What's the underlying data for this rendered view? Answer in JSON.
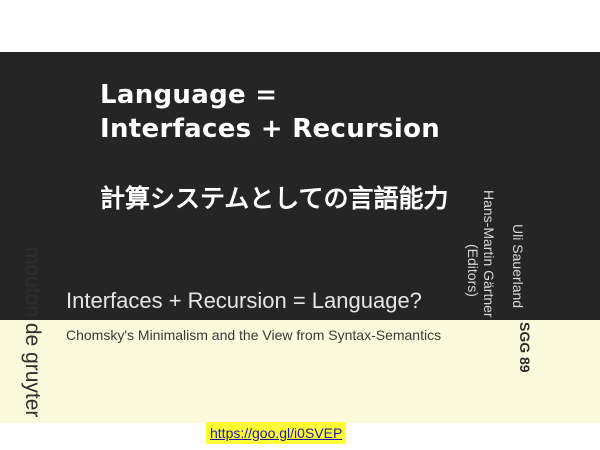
{
  "slide": {
    "title_line1": "Language =",
    "title_line2": "Interfaces + Recursion",
    "subtitle": "計算システムとしての言語能力",
    "link": "https://goo.gl/i0SVEP"
  },
  "book_cover": {
    "publisher": "mouton de gruyter",
    "title": "Interfaces + Recursion = Language?",
    "subtitle": "Chomsky's Minimalism and the View from Syntax-Semantics",
    "editor1": "Uli Sauerland",
    "editor2": "Hans-Martin Gärtner",
    "editors_note": "(Editors)",
    "series": "SGG 89"
  },
  "colors": {
    "dark_band": "#252525",
    "cream_band": "#fdf9dd",
    "link_highlight": "#ffff33",
    "link_text": "#1a1aa6"
  }
}
